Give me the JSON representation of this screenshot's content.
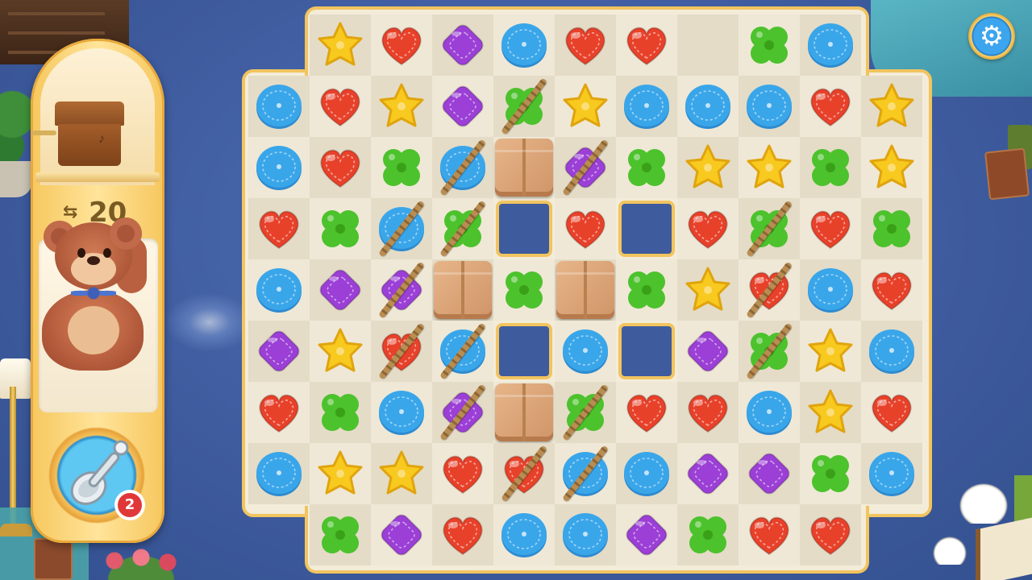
{
  "hud": {
    "moves_left": "20",
    "moves_icon": "swap-arrows-icon",
    "goal": {
      "item": "teddy-bear",
      "icon": "teddy-bear-icon"
    },
    "goal_image": "music-box",
    "booster": {
      "name": "spoon",
      "icon": "spoon-icon",
      "count": "2"
    },
    "settings_icon": "⚙"
  },
  "colors": {
    "heart": "#e8412a",
    "star": "#f8c91e",
    "diamond": "#9b3fd6",
    "button": "#3aa6ea",
    "clover": "#4cc22c",
    "frame": "#f1c45f",
    "board": "#f3ecd9"
  },
  "board": {
    "cols": 11,
    "rows": 9,
    "legend": {
      "H": "heart",
      "S": "star",
      "D": "diamond",
      "B": "button",
      "C": "clover",
      "X": "wooden-crate",
      "O": "hole",
      "_": "empty"
    },
    "grid": [
      [
        "O",
        "S",
        "H",
        "D",
        "B",
        "H",
        "H",
        "_",
        "C",
        "B",
        "O"
      ],
      [
        "B",
        "H",
        "S",
        "D",
        "C",
        "S",
        "B",
        "B",
        "B",
        "H",
        "S"
      ],
      [
        "B",
        "H",
        "C",
        "B",
        "X",
        "D",
        "C",
        "S",
        "S",
        "C",
        "S"
      ],
      [
        "H",
        "C",
        "B",
        "C",
        "O",
        "H",
        "O",
        "H",
        "C",
        "H",
        "C"
      ],
      [
        "B",
        "D",
        "D",
        "X",
        "C",
        "X",
        "C",
        "S",
        "H",
        "B",
        "H"
      ],
      [
        "D",
        "S",
        "H",
        "B",
        "O",
        "B",
        "O",
        "D",
        "C",
        "S",
        "B"
      ],
      [
        "H",
        "C",
        "B",
        "D",
        "X",
        "C",
        "H",
        "H",
        "B",
        "S",
        "H"
      ],
      [
        "B",
        "S",
        "S",
        "H",
        "H",
        "B",
        "B",
        "D",
        "D",
        "C",
        "B"
      ],
      [
        "O",
        "C",
        "D",
        "H",
        "B",
        "B",
        "D",
        "C",
        "H",
        "H",
        "O"
      ]
    ],
    "roped": [
      [
        1,
        4
      ],
      [
        2,
        3
      ],
      [
        2,
        5
      ],
      [
        3,
        2
      ],
      [
        3,
        3
      ],
      [
        3,
        8
      ],
      [
        4,
        2
      ],
      [
        4,
        8
      ],
      [
        5,
        2
      ],
      [
        5,
        3
      ],
      [
        5,
        8
      ],
      [
        6,
        3
      ],
      [
        6,
        5
      ],
      [
        7,
        4
      ],
      [
        7,
        5
      ]
    ]
  }
}
